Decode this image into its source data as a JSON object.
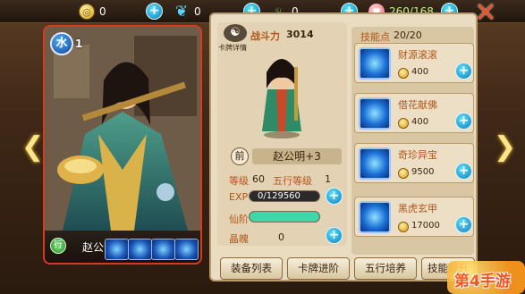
{
  "topbar": {
    "gold": {
      "icon": "gold-coin-icon",
      "value": "0"
    },
    "jade": {
      "icon": "jade-drop-icon",
      "value": "0"
    },
    "spirit": {
      "icon": "green-flame-icon",
      "value": "0"
    },
    "peach": {
      "icon": "peach-icon",
      "value": "260/168"
    }
  },
  "card": {
    "element": "水",
    "level": "1",
    "name": "赵公明",
    "name_badge": "行",
    "skill_count": 4
  },
  "stats": {
    "card_detail_label": "卡牌详情",
    "power_label": "战斗力",
    "power_value": "3014",
    "front_label": "前",
    "hero_name": "赵公明+3",
    "level_label": "等级",
    "level_value": "60",
    "wuxing_label": "五行等级",
    "wuxing_value": "1",
    "exp_label": "EXP",
    "exp_value": "0/129560",
    "exp_fraction": 0.0,
    "xianyin_label": "仙阶",
    "xianyin_fraction": 1.0,
    "jinghun_label": "晶魄",
    "jinghun_value": "0"
  },
  "skills": {
    "points_label": "技能点",
    "points_value": "20/20",
    "items": [
      {
        "name": "财源滚滚",
        "cost": "400",
        "icon": "blue-swirl-skill-icon"
      },
      {
        "name": "借花献佛",
        "cost": "400",
        "icon": "blue-flower-skill-icon"
      },
      {
        "name": "奇珍异宝",
        "cost": "9500",
        "icon": "blue-treasure-skill-icon"
      },
      {
        "name": "黑虎玄甲",
        "cost": "17000",
        "icon": "blue-tiger-skill-icon"
      }
    ]
  },
  "buttons": {
    "equip": "装备列表",
    "advance": "卡牌进阶",
    "wuxing": "五行培养",
    "skill": "技能提升"
  },
  "watermark": "第4手游",
  "colors": {
    "card_border": "#d73b1f",
    "exp_bar": "#1a1a1a",
    "xianyin_bar": "#3fd6a8",
    "accent": "#b0571a"
  }
}
